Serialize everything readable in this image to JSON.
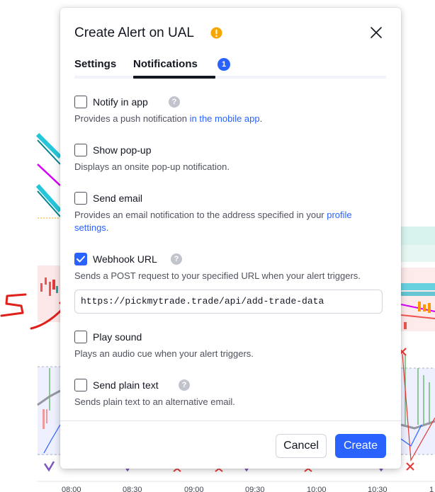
{
  "dialog": {
    "title": "Create Alert on UAL",
    "close_icon": "close-icon",
    "warning_icon": "warning-icon"
  },
  "tabs": [
    {
      "label": "Settings",
      "active": false
    },
    {
      "label": "Notifications",
      "active": true,
      "badge": "1"
    }
  ],
  "notifications": {
    "notify_in_app": {
      "label": "Notify in app",
      "checked": false,
      "desc_prefix": "Provides a push notification ",
      "desc_link": "in the mobile app",
      "desc_suffix": "."
    },
    "show_popup": {
      "label": "Show pop-up",
      "checked": false,
      "desc": "Displays an onsite pop-up notification."
    },
    "send_email": {
      "label": "Send email",
      "checked": false,
      "desc_prefix": "Provides an email notification to the address specified in your ",
      "desc_link": "profile settings",
      "desc_suffix": "."
    },
    "webhook_url": {
      "label": "Webhook URL",
      "checked": true,
      "desc": "Sends a POST request to your specified URL when your alert triggers.",
      "value": "https://pickmytrade.trade/api/add-trade-data"
    },
    "play_sound": {
      "label": "Play sound",
      "checked": false,
      "desc": "Plays an audio cue when your alert triggers."
    },
    "send_plain_text": {
      "label": "Send plain text",
      "checked": false,
      "desc": "Sends plain text to an alternative email."
    }
  },
  "buttons": {
    "cancel": "Cancel",
    "create": "Create"
  },
  "chart": {
    "time_labels": [
      "08:00",
      "08:30",
      "09:00",
      "09:30",
      "10:00",
      "10:30",
      "1"
    ]
  },
  "annotation": {
    "text": "5"
  },
  "colors": {
    "accent": "#2962ff",
    "warning": "#f7a600",
    "annotation": "#e0201b"
  }
}
